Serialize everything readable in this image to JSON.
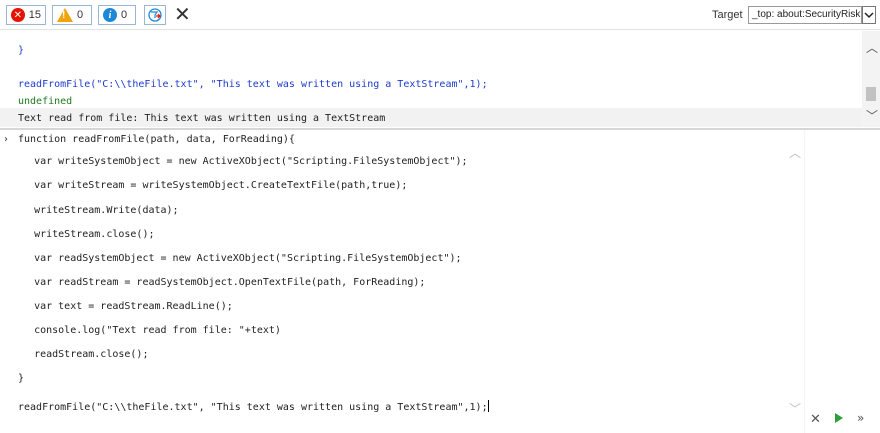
{
  "toolbar": {
    "errors_count": "15",
    "warnings_count": "0",
    "info_count": "0",
    "warning_mark": "!",
    "info_mark": "i",
    "error_mark": "✕",
    "clear_glyph": "✕",
    "target_label": "Target",
    "target_value": "_top: about:SecurityRisk",
    "icons": [
      "error-icon",
      "warning-icon",
      "info-icon",
      "filter-icon",
      "clear-icon",
      "dropdown-arrow-icon"
    ]
  },
  "output": {
    "lines": [
      {
        "text": "}",
        "style": "blue"
      },
      {
        "text": "readFromFile(\"C:\\\\theFile.txt\", \"This text was written using a TextStream\",1);",
        "style": "blue"
      },
      {
        "text": "undefined",
        "style": "green"
      },
      {
        "text": "Text read from file: This text was written using a TextStream",
        "style": "plain"
      }
    ]
  },
  "editor": {
    "prompt": "›",
    "lines": [
      "function readFromFile(path, data, ForReading){",
      "    var writeSystemObject = new ActiveXObject(\"Scripting.FileSystemObject\");",
      "    var writeStream = writeSystemObject.CreateTextFile(path,true);",
      "    writeStream.Write(data);",
      "    writeStream.close();",
      "    var readSystemObject = new ActiveXObject(\"Scripting.FileSystemObject\");",
      "    var readStream = readSystemObject.OpenTextFile(path, ForReading);",
      "    var text = readStream.ReadLine();",
      "    console.log(\"Text read from file: \"+text)",
      "    readStream.close();",
      "}",
      "readFromFile(\"C:\\\\theFile.txt\", \"This text was written using a TextStream\",1);"
    ]
  },
  "colors": {
    "error": "#e51400",
    "warning": "#f0a30a",
    "info": "#1e88d8",
    "code_blue": "#1e3bd0",
    "result_green": "#1f7a1f",
    "run_green": "#2e9e3a"
  }
}
